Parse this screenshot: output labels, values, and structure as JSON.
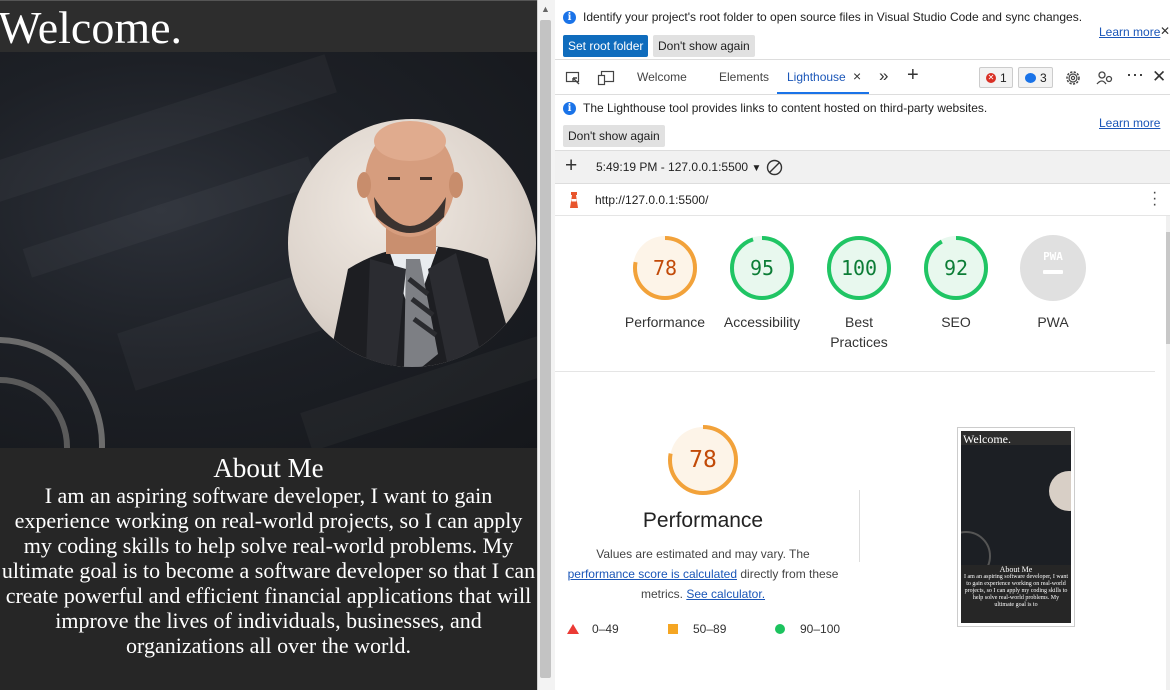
{
  "site": {
    "title": "Welcome.",
    "about_title": "About Me",
    "about_text": "I am an aspiring software developer, I want to gain experience working on real-world projects, so I can apply my coding skills to help solve real-world problems. My ultimate goal is to become a software developer so that I can create powerful and efficient financial applications that will improve the lives of individuals, businesses, and organizations all over the world."
  },
  "devtools": {
    "infobar1": {
      "message": "Identify your project's root folder to open source files in Visual Studio Code and sync changes.",
      "set_root_label": "Set root folder",
      "dont_show_label": "Don't show again",
      "learn_more": "Learn more",
      "close_glyph": "✕"
    },
    "tabs": {
      "welcome": "Welcome",
      "elements": "Elements",
      "lighthouse": "Lighthouse",
      "lighthouse_close": "×",
      "more": "»",
      "add": "+",
      "error_count": "1",
      "message_count": "3"
    },
    "infobar2": {
      "message": "The Lighthouse tool provides links to content hosted on third-party websites.",
      "dont_show_label": "Don't show again",
      "learn_more": "Learn more"
    },
    "report": {
      "add": "+",
      "timestamp": "5:49:19 PM - 127.0.0.1:5500",
      "dropdown": "▼",
      "url": "http://127.0.0.1:5500/"
    },
    "scores": [
      {
        "value": "78",
        "label": "Performance",
        "score": 78,
        "color": "#f2a23a",
        "fill": "#fdf4e8",
        "text": "#c24a08"
      },
      {
        "value": "95",
        "label": "Accessibility",
        "score": 95,
        "color": "#20c564",
        "fill": "#e8f8ee",
        "text": "#0c7d36"
      },
      {
        "value": "100",
        "label": "Best Practices",
        "score": 100,
        "color": "#20c564",
        "fill": "#e8f8ee",
        "text": "#0c7d36"
      },
      {
        "value": "92",
        "label": "SEO",
        "score": 92,
        "color": "#20c564",
        "fill": "#e8f8ee",
        "text": "#0c7d36"
      },
      {
        "value": "PWA",
        "label": "PWA",
        "score": 0,
        "color": "#e0e0e0",
        "fill": "#e0e0e0",
        "text": "#ffffff"
      }
    ],
    "performance": {
      "value": "78",
      "title": "Performance",
      "desc_1": "Values are estimated and may vary. The",
      "link_1": "performance score is calculated",
      "desc_2": "directly from these",
      "desc_3": "metrics.",
      "link_2": "See calculator.",
      "legend": [
        {
          "range": "0–49",
          "color": "#eb3a35",
          "shape": "triangle"
        },
        {
          "range": "50–89",
          "color": "#f5a623",
          "shape": "square"
        },
        {
          "range": "90–100",
          "color": "#1cc35e",
          "shape": "circle"
        }
      ]
    },
    "thumbnail": {
      "title": "Welcome.",
      "about_title": "About Me",
      "about_text": "I am an aspiring software developer, I want to gain experience working on real-world projects, so I can apply my coding skills to help solve real-world problems. My ultimate goal is to"
    }
  }
}
